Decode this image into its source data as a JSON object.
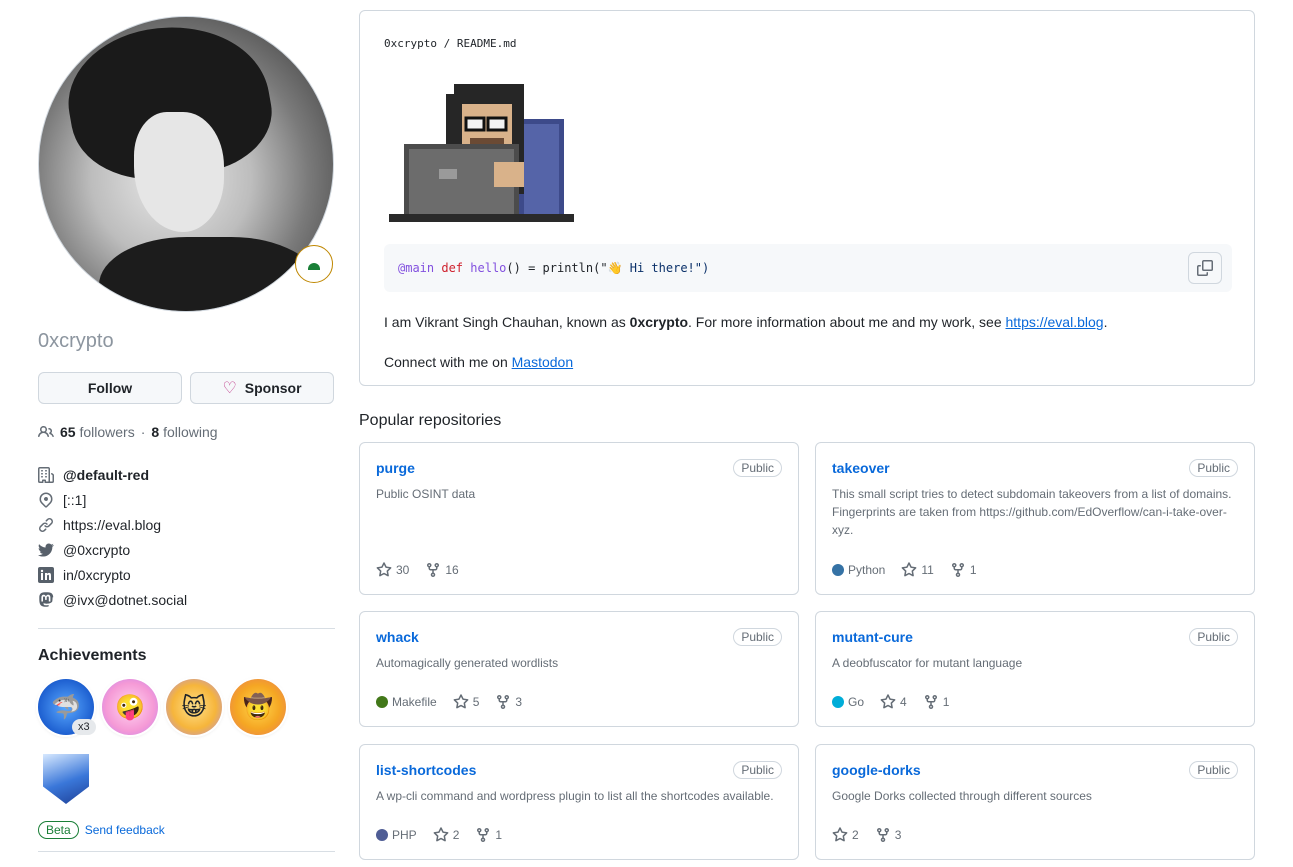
{
  "profile": {
    "username": "0xcrypto",
    "follow_label": "Follow",
    "sponsor_label": "Sponsor",
    "followers_count": "65",
    "followers_label": "followers",
    "separator": "·",
    "following_count": "8",
    "following_label": "following",
    "details": [
      {
        "icon": "organization-icon",
        "text": "@default-red",
        "bold": true
      },
      {
        "icon": "location-icon",
        "text": "[::1]"
      },
      {
        "icon": "link-icon",
        "text": "https://eval.blog"
      },
      {
        "icon": "twitter-icon",
        "text": "@0xcrypto"
      },
      {
        "icon": "linkedin-icon",
        "text": "in/0xcrypto"
      },
      {
        "icon": "mastodon-icon",
        "text": "@ivx@dotnet.social"
      }
    ]
  },
  "achievements": {
    "title": "Achievements",
    "badges": [
      {
        "icon": "shark-badge-icon",
        "multiplier": "x3"
      },
      {
        "icon": "yolo-badge-icon"
      },
      {
        "icon": "pull-shark-badge-icon"
      },
      {
        "icon": "cowboy-badge-icon"
      },
      {
        "icon": "arctic-vault-badge-icon"
      }
    ],
    "beta_label": "Beta",
    "feedback_label": "Send feedback"
  },
  "readme": {
    "owner": "0xcrypto",
    "slash": " / ",
    "file": "README.md",
    "code": {
      "annotation": "@main",
      "keyword": "def",
      "func": "hello",
      "rest": "() = println(\"",
      "emoji": "👋",
      "string": " Hi there!\")"
    },
    "intro_prefix": "I am Vikrant Singh Chauhan, known as ",
    "intro_bold": "0xcrypto",
    "intro_mid": ". For more information about me and my work, see ",
    "intro_link": "https://eval.blog",
    "intro_suffix": ".",
    "connect_prefix": "Connect with me on ",
    "connect_link": "Mastodon"
  },
  "popular": {
    "title": "Popular repositories",
    "public_label": "Public",
    "repos": [
      {
        "name": "purge",
        "desc": "Public OSINT data",
        "lang": "",
        "lang_color": "",
        "stars": "30",
        "forks": "16"
      },
      {
        "name": "takeover",
        "desc": "This small script tries to detect subdomain takeovers from a list of domains. Fingerprints are taken from https://github.com/EdOverflow/can-i-take-over-xyz.",
        "lang": "Python",
        "lang_color": "#3572A5",
        "stars": "11",
        "forks": "1"
      },
      {
        "name": "whack",
        "desc": "Automagically generated wordlists",
        "lang": "Makefile",
        "lang_color": "#427819",
        "stars": "5",
        "forks": "3"
      },
      {
        "name": "mutant-cure",
        "desc": "A deobfuscator for mutant language",
        "lang": "Go",
        "lang_color": "#00ADD8",
        "stars": "4",
        "forks": "1"
      },
      {
        "name": "list-shortcodes",
        "desc": "A wp-cli command and wordpress plugin to list all the shortcodes available.",
        "lang": "PHP",
        "lang_color": "#4F5D95",
        "stars": "2",
        "forks": "1"
      },
      {
        "name": "google-dorks",
        "desc": "Google Dorks collected through different sources",
        "lang": "",
        "lang_color": "",
        "stars": "2",
        "forks": "3"
      }
    ]
  }
}
